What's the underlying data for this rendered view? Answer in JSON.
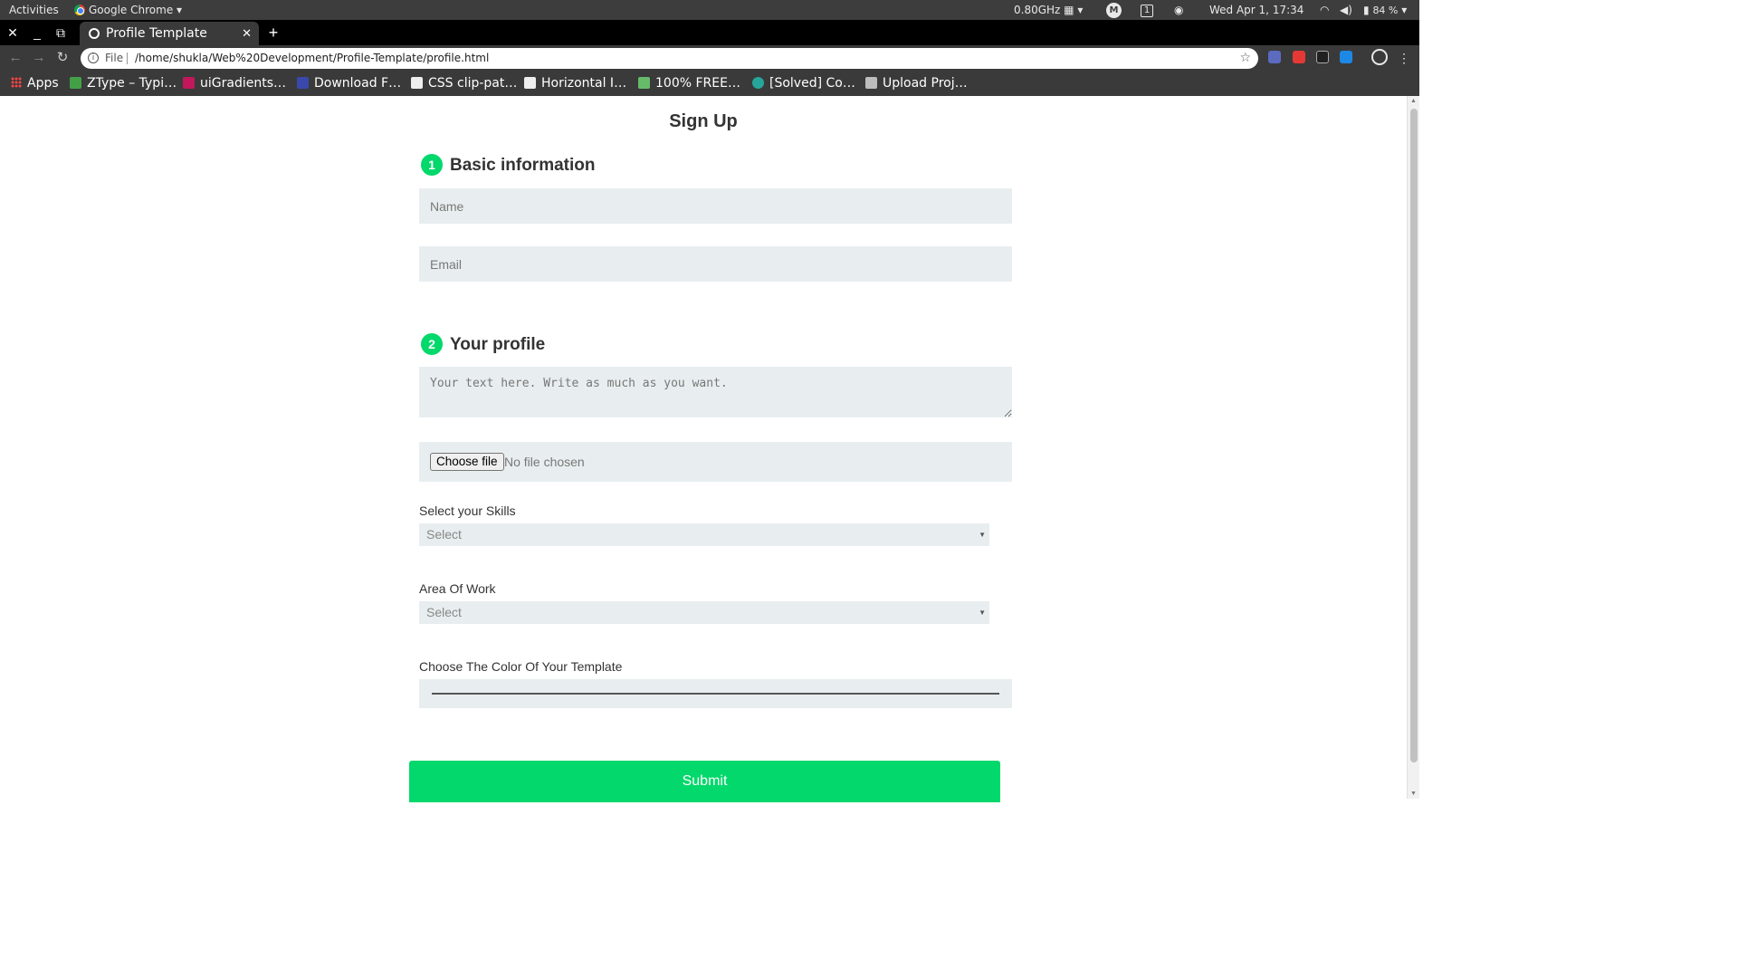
{
  "os": {
    "activities": "Activities",
    "app_name": "Google Chrome",
    "app_caret": "▾",
    "cpu": "0.80GHz",
    "workspace": "1",
    "datetime": "Wed Apr  1, 17:34",
    "battery": "84 %"
  },
  "browser": {
    "tab_title": "Profile Template",
    "url_scheme": "File",
    "url": "/home/shukla/Web%20Development/Profile-Template/profile.html",
    "bookmarks": [
      {
        "label": "Apps",
        "color": "#e53935"
      },
      {
        "label": "ZType – Typi…",
        "color": "#43a047"
      },
      {
        "label": "uiGradients…",
        "color": "#c2185b"
      },
      {
        "label": "Download F…",
        "color": "#3949ab"
      },
      {
        "label": "CSS clip-pat…",
        "color": "#eeeeee"
      },
      {
        "label": "Horizontal I…",
        "color": "#eeeeee"
      },
      {
        "label": "100% FREE…",
        "color": "#66bb6a"
      },
      {
        "label": "[Solved] Co…",
        "color": "#26a69a"
      },
      {
        "label": "Upload Proj…",
        "color": "#bdbdbd"
      }
    ]
  },
  "form": {
    "title": "Sign Up",
    "section1": {
      "number": "1",
      "title": "Basic information"
    },
    "name_placeholder": "Name",
    "email_placeholder": "Email",
    "section2": {
      "number": "2",
      "title": "Your profile"
    },
    "profile_placeholder": "Your text here. Write as much as you want.",
    "file_button": "Choose file",
    "file_status": "No file chosen",
    "skills_label": "Select your Skills",
    "skills_value": "Select",
    "area_label": "Area Of Work",
    "area_value": "Select",
    "color_label": "Choose The Color Of Your Template",
    "submit": "Submit"
  },
  "colors": {
    "accent": "#02d86b",
    "field_bg": "#e8eeef"
  }
}
